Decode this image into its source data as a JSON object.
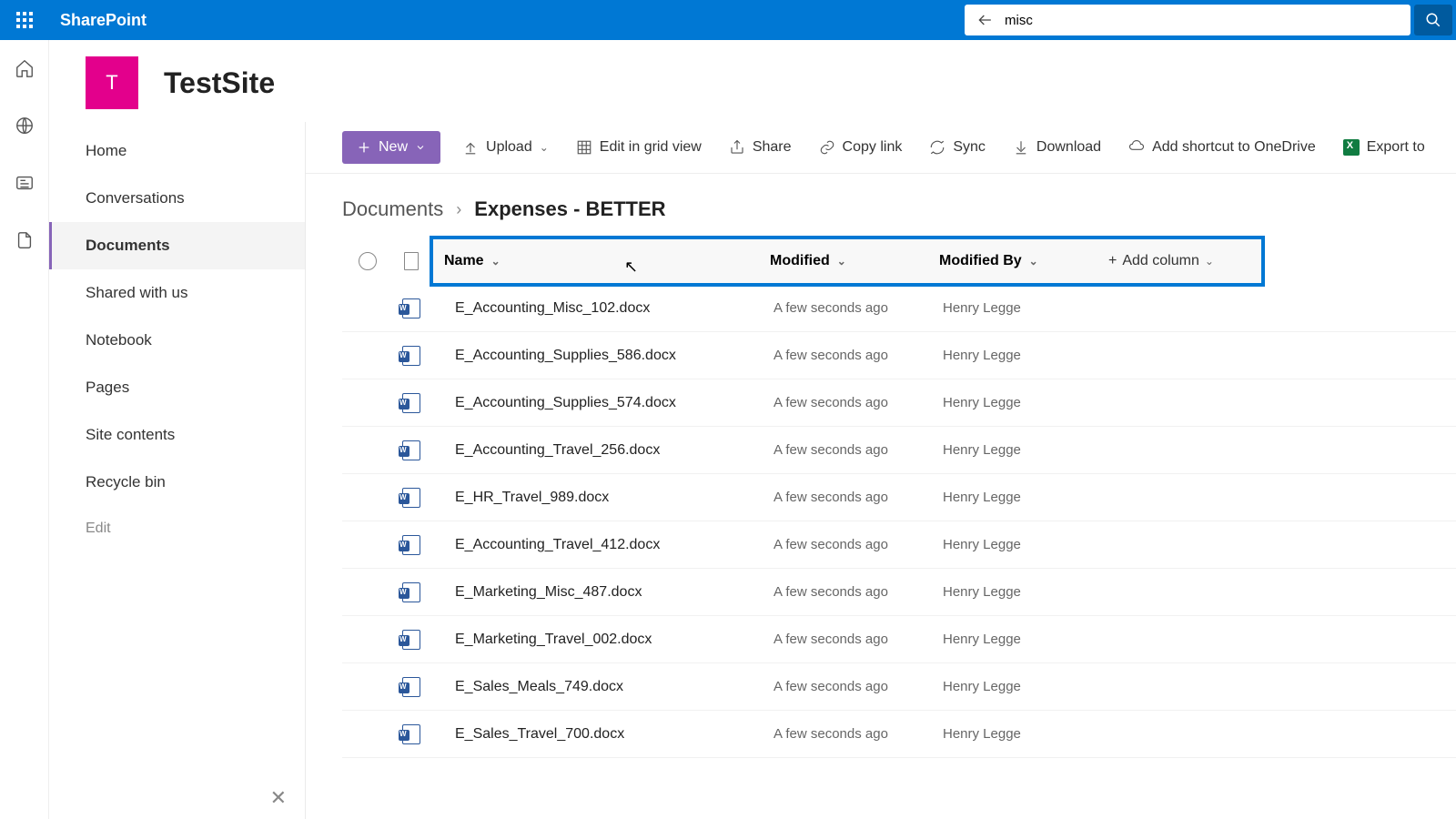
{
  "brand": "SharePoint",
  "search": {
    "value": "misc"
  },
  "site": {
    "initial": "T",
    "title": "TestSite"
  },
  "nav": {
    "items": [
      "Home",
      "Conversations",
      "Documents",
      "Shared with us",
      "Notebook",
      "Pages",
      "Site contents",
      "Recycle bin"
    ],
    "edit": "Edit"
  },
  "toolbar": {
    "new": "New",
    "upload": "Upload",
    "editGrid": "Edit in grid view",
    "share": "Share",
    "copyLink": "Copy link",
    "sync": "Sync",
    "download": "Download",
    "shortcut": "Add shortcut to OneDrive",
    "export": "Export to"
  },
  "breadcrumb": {
    "root": "Documents",
    "current": "Expenses - BETTER"
  },
  "columns": {
    "name": "Name",
    "modified": "Modified",
    "modifiedBy": "Modified By",
    "add": "Add column"
  },
  "files": [
    {
      "name": "E_Accounting_Misc_102.docx",
      "modified": "A few seconds ago",
      "by": "Henry Legge"
    },
    {
      "name": "E_Accounting_Supplies_586.docx",
      "modified": "A few seconds ago",
      "by": "Henry Legge"
    },
    {
      "name": "E_Accounting_Supplies_574.docx",
      "modified": "A few seconds ago",
      "by": "Henry Legge"
    },
    {
      "name": "E_Accounting_Travel_256.docx",
      "modified": "A few seconds ago",
      "by": "Henry Legge"
    },
    {
      "name": "E_HR_Travel_989.docx",
      "modified": "A few seconds ago",
      "by": "Henry Legge"
    },
    {
      "name": "E_Accounting_Travel_412.docx",
      "modified": "A few seconds ago",
      "by": "Henry Legge"
    },
    {
      "name": "E_Marketing_Misc_487.docx",
      "modified": "A few seconds ago",
      "by": "Henry Legge"
    },
    {
      "name": "E_Marketing_Travel_002.docx",
      "modified": "A few seconds ago",
      "by": "Henry Legge"
    },
    {
      "name": "E_Sales_Meals_749.docx",
      "modified": "A few seconds ago",
      "by": "Henry Legge"
    },
    {
      "name": "E_Sales_Travel_700.docx",
      "modified": "A few seconds ago",
      "by": "Henry Legge"
    }
  ]
}
